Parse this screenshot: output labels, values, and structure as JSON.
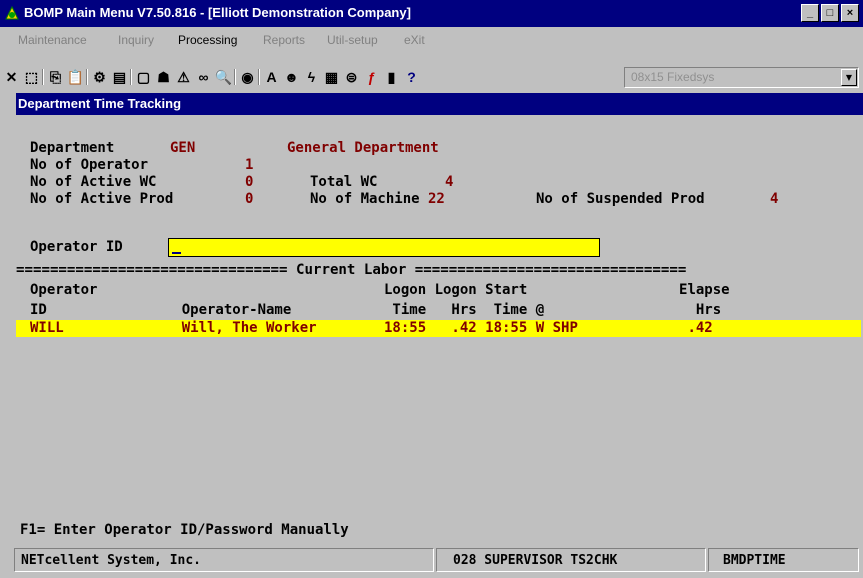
{
  "window": {
    "title": "BOMP Main Menu V7.50.816 - [Elliott Demonstration Company]",
    "minimize": "_",
    "restore": "□",
    "close": "×"
  },
  "menu": [
    {
      "label": "Maintenance",
      "enabled": false
    },
    {
      "label": "Inquiry",
      "enabled": false
    },
    {
      "label": "Processing",
      "enabled": true
    },
    {
      "label": "Reports",
      "enabled": false
    },
    {
      "label": "Util-setup",
      "enabled": false
    },
    {
      "label": "eXit",
      "enabled": false
    }
  ],
  "toolbar": {
    "icons": [
      "close-icon",
      "select-icon",
      "copy-icon",
      "paste-icon",
      "settings-icon",
      "document-icon",
      "window-icon",
      "people-icon",
      "warning-icon",
      "binoculars-icon",
      "search-icon",
      "globe-icon",
      "font-icon",
      "user-icon",
      "bolt-icon",
      "calculator-icon",
      "link-icon",
      "function-icon",
      "book-icon",
      "help-icon"
    ],
    "font_select": "08x15 Fixedsys"
  },
  "screen": {
    "title": "Department Time Tracking",
    "department_label": "Department",
    "department_code": "GEN",
    "department_name": "General Department",
    "no_of_operator_label": "No of Operator",
    "no_of_operator": "1",
    "no_of_active_wc_label": "No of Active WC",
    "no_of_active_wc": "0",
    "total_wc_label": "Total WC",
    "total_wc": "4",
    "no_of_active_prod_label": "No of Active Prod",
    "no_of_active_prod": "0",
    "no_of_machine_label": "No of Machine",
    "no_of_machine": "22",
    "no_of_suspended_label": "No of Suspended Prod",
    "no_of_suspended": "4",
    "operator_id_label": "Operator ID",
    "operator_id_value": "",
    "divider": "================================ Current Labor ================================",
    "header1": "Operator                                  Logon Logon Start                  Elapse",
    "header2": "ID                Operator-Name            Time   Hrs  Time @                  Hrs",
    "rows": [
      {
        "text": "WILL              Will, The Worker        18:55   .42 18:55 W SHP             .42"
      }
    ],
    "hint": "F1= Enter Operator ID/Password Manually"
  },
  "status": {
    "company": "NETcellent System, Inc.",
    "session": "028 SUPERVISOR TS2CHK",
    "program": "BMDPTIME"
  }
}
